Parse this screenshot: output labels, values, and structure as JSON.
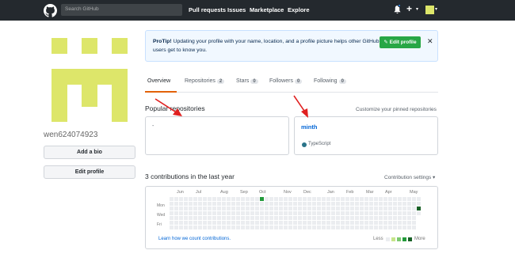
{
  "header": {
    "search_placeholder": "Search GitHub",
    "nav": [
      "Pull requests",
      "Issues",
      "Marketplace",
      "Explore"
    ]
  },
  "profile": {
    "username": "wen624074923",
    "add_bio_label": "Add a bio",
    "edit_profile_label": "Edit profile",
    "avatar_color": "#dde66a"
  },
  "protip": {
    "title": "ProTip!",
    "text": "Updating your profile with your name, location, and a profile picture helps other GitHub users get to know you.",
    "edit_button": "Edit profile",
    "close": "✕"
  },
  "tabs": [
    {
      "label": "Overview",
      "count": ""
    },
    {
      "label": "Repositories",
      "count": "2"
    },
    {
      "label": "Stars",
      "count": "0"
    },
    {
      "label": "Followers",
      "count": "0"
    },
    {
      "label": "Following",
      "count": "0"
    }
  ],
  "popular": {
    "title": "Popular repositories",
    "customize": "Customize your pinned repositories",
    "repos": [
      {
        "name": "-",
        "language": ""
      },
      {
        "name": "minth",
        "language": "TypeScript"
      }
    ]
  },
  "contributions": {
    "title": "3 contributions in the last year",
    "settings": "Contribution settings ▾",
    "months": [
      "Jun",
      "Jul",
      "Aug",
      "Sep",
      "Oct",
      "Nov",
      "Dec",
      "Jan",
      "Feb",
      "Mar",
      "Apr",
      "May"
    ],
    "days": [
      "Mon",
      "Wed",
      "Fri"
    ],
    "learn": "Learn how we count contributions.",
    "less": "Less",
    "more": "More",
    "empty_color": "#ebedf0",
    "legend_colors": [
      "#ebedf0",
      "#c6e48b",
      "#7bc96f",
      "#239a3b",
      "#196127"
    ]
  },
  "colors": {
    "accent": "#28a745",
    "link": "#0366d6",
    "tab_underline": "#e36209",
    "annotation_arrow": "#e02020"
  }
}
